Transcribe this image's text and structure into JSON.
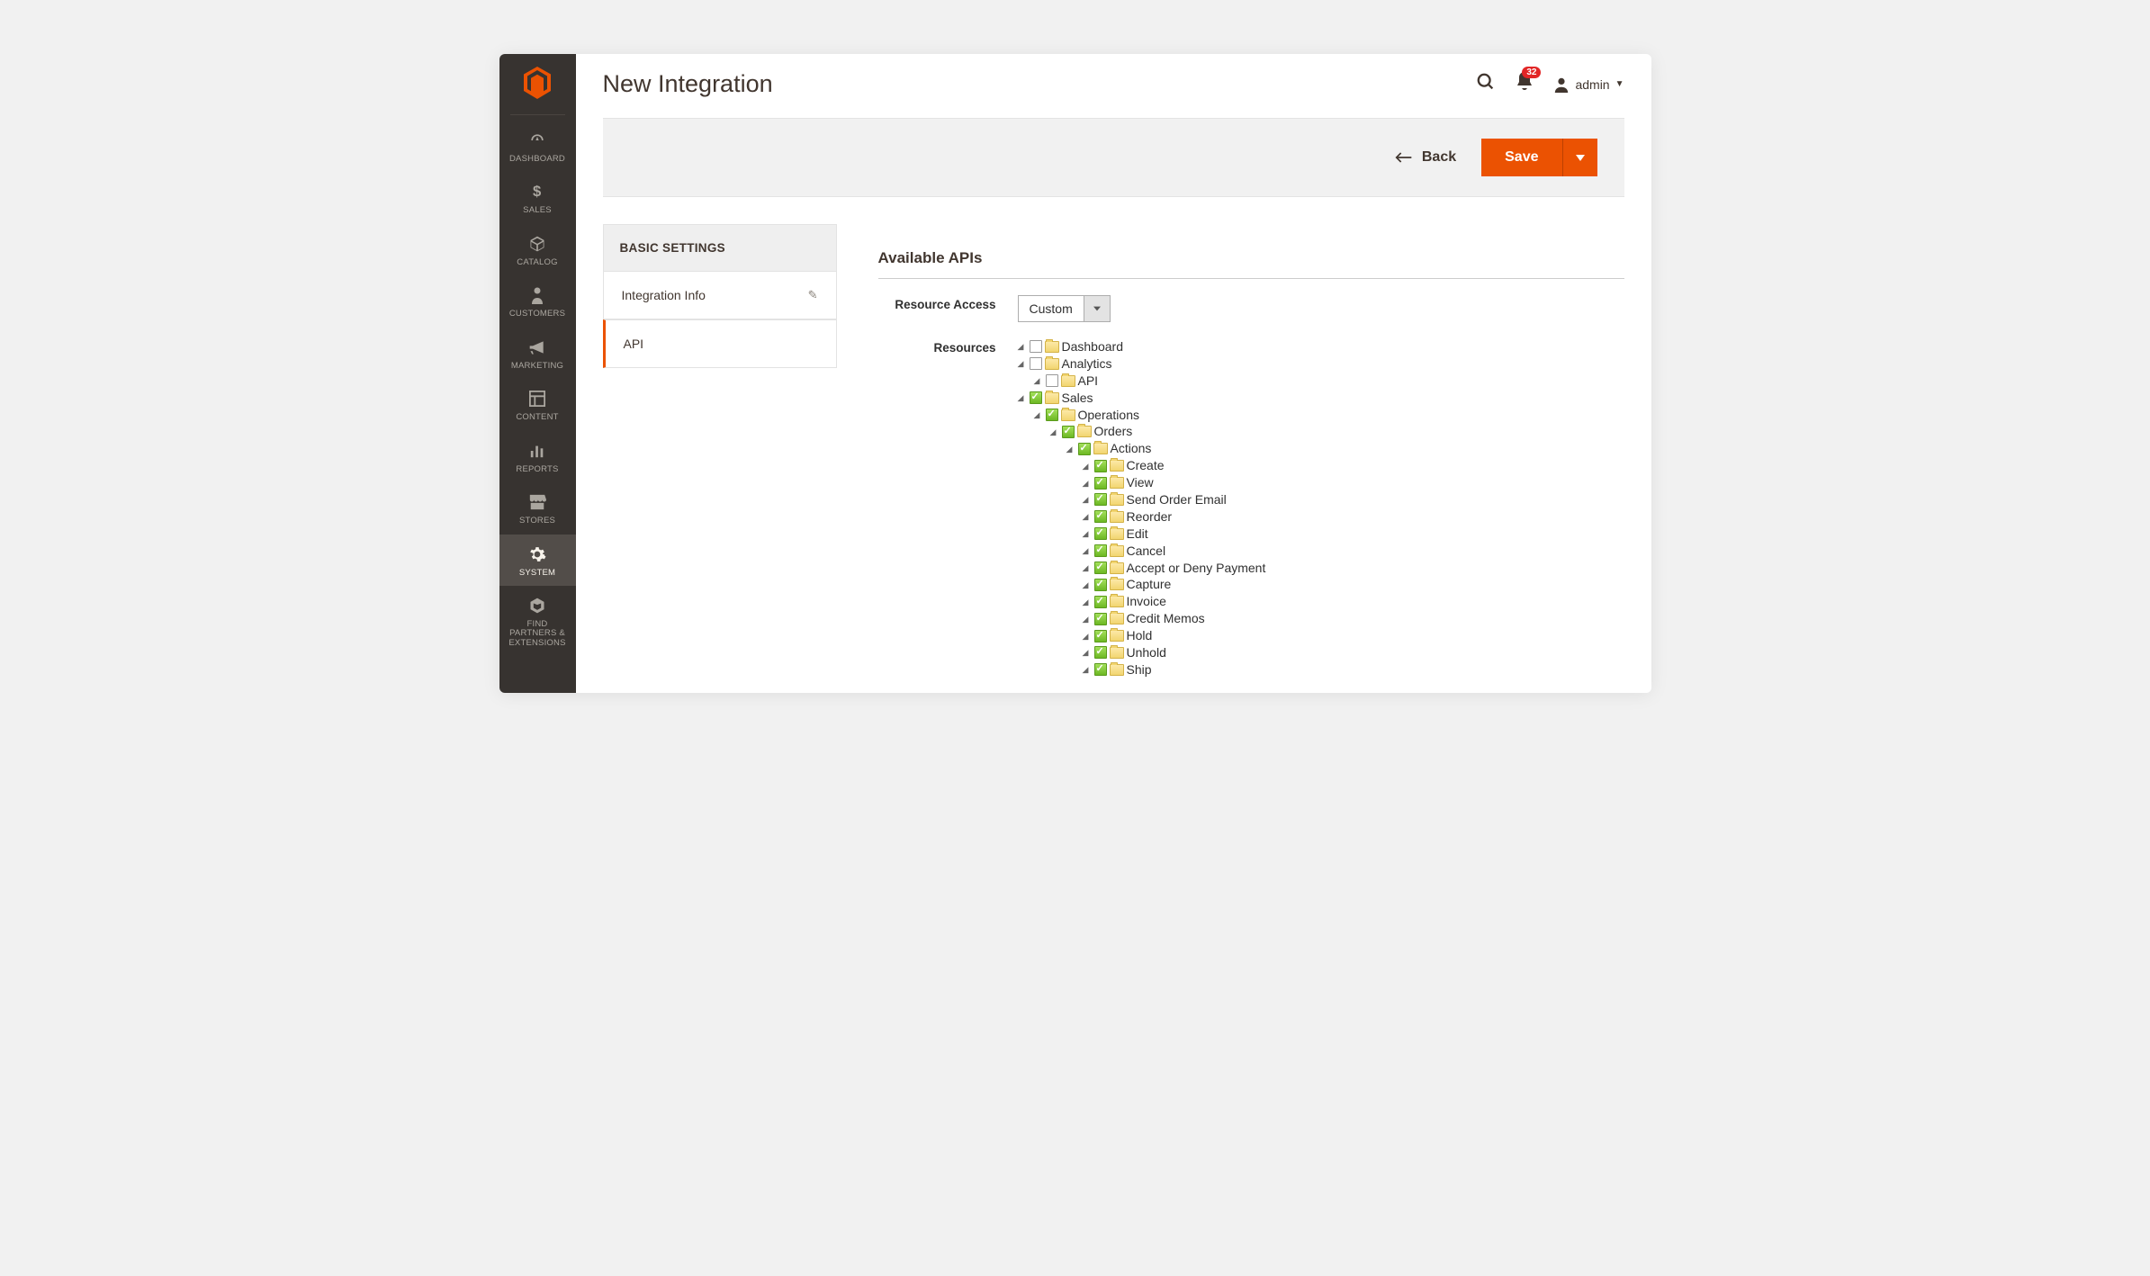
{
  "page": {
    "title": "New Integration"
  },
  "header": {
    "notif_count": "32",
    "admin_label": "admin"
  },
  "actions": {
    "back_label": "Back",
    "save_label": "Save"
  },
  "sidebar": {
    "items": [
      {
        "label": "DASHBOARD"
      },
      {
        "label": "SALES"
      },
      {
        "label": "CATALOG"
      },
      {
        "label": "CUSTOMERS"
      },
      {
        "label": "MARKETING"
      },
      {
        "label": "CONTENT"
      },
      {
        "label": "REPORTS"
      },
      {
        "label": "STORES"
      },
      {
        "label": "SYSTEM"
      },
      {
        "label": "FIND PARTNERS & EXTENSIONS"
      }
    ]
  },
  "panel": {
    "header": "BASIC SETTINGS",
    "tabs": [
      {
        "label": "Integration Info"
      },
      {
        "label": "API"
      }
    ]
  },
  "form": {
    "section_title": "Available APIs",
    "resource_access_label": "Resource Access",
    "resource_access_value": "Custom",
    "resources_label": "Resources"
  },
  "tree": [
    {
      "label": "Dashboard",
      "checked": false,
      "expanded": true,
      "children": []
    },
    {
      "label": "Analytics",
      "checked": false,
      "expanded": true,
      "children": [
        {
          "label": "API",
          "checked": false,
          "expanded": true,
          "children": []
        }
      ]
    },
    {
      "label": "Sales",
      "checked": true,
      "expanded": true,
      "children": [
        {
          "label": "Operations",
          "checked": true,
          "expanded": true,
          "children": [
            {
              "label": "Orders",
              "checked": true,
              "expanded": true,
              "children": [
                {
                  "label": "Actions",
                  "checked": true,
                  "expanded": true,
                  "children": [
                    {
                      "label": "Create",
                      "checked": true,
                      "expanded": true,
                      "children": []
                    },
                    {
                      "label": "View",
                      "checked": true,
                      "expanded": true,
                      "children": []
                    },
                    {
                      "label": "Send Order Email",
                      "checked": true,
                      "expanded": true,
                      "children": []
                    },
                    {
                      "label": "Reorder",
                      "checked": true,
                      "expanded": true,
                      "children": []
                    },
                    {
                      "label": "Edit",
                      "checked": true,
                      "expanded": true,
                      "children": []
                    },
                    {
                      "label": "Cancel",
                      "checked": true,
                      "expanded": true,
                      "children": []
                    },
                    {
                      "label": "Accept or Deny Payment",
                      "checked": true,
                      "expanded": true,
                      "children": []
                    },
                    {
                      "label": "Capture",
                      "checked": true,
                      "expanded": true,
                      "children": []
                    },
                    {
                      "label": "Invoice",
                      "checked": true,
                      "expanded": true,
                      "children": []
                    },
                    {
                      "label": "Credit Memos",
                      "checked": true,
                      "expanded": true,
                      "children": []
                    },
                    {
                      "label": "Hold",
                      "checked": true,
                      "expanded": true,
                      "children": []
                    },
                    {
                      "label": "Unhold",
                      "checked": true,
                      "expanded": true,
                      "children": []
                    },
                    {
                      "label": "Ship",
                      "checked": true,
                      "expanded": true,
                      "children": []
                    }
                  ]
                }
              ]
            }
          ]
        }
      ]
    }
  ]
}
